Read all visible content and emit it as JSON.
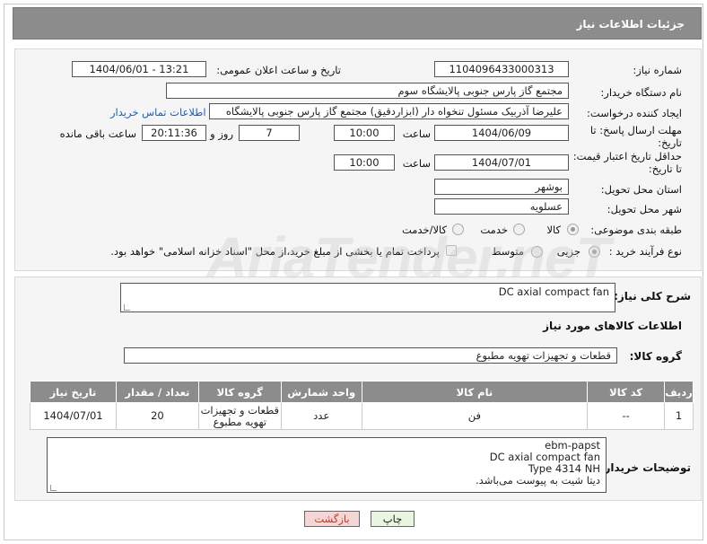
{
  "header": {
    "title": "جزئیات اطلاعات نیاز"
  },
  "form": {
    "need_number_label": "شماره نیاز:",
    "need_number": "1104096433000313",
    "announce_label": "تاریخ و ساعت اعلان عمومی:",
    "announce_value": "1404/06/01 - 13:21",
    "buyer_org_label": "نام دستگاه خریدار:",
    "buyer_org": "مجتمع گاز پارس جنوبی  پالایشگاه سوم",
    "creator_label": "ایجاد کننده درخواست:",
    "creator": "علیرضا آذربیک مسئول تنخواه دار  (ابزاردقیق) مجتمع گاز پارس جنوبی  پالایشگاه",
    "contact_link": "اطلاعات تماس خریدار",
    "deadline_label_1": "مهلت ارسال پاسخ: تا",
    "deadline_label_2": "تاریخ:",
    "deadline_date": "1404/06/09",
    "time_label": "ساعت",
    "deadline_time": "10:00",
    "days_value": "7",
    "days_label": "روز و",
    "remaining_value": "20:11:36",
    "remaining_label": "ساعت باقی مانده",
    "price_valid_label_1": "حداقل تاریخ اعتبار قیمت:",
    "price_valid_label_2": "تا تاریخ:",
    "price_valid_date": "1404/07/01",
    "price_valid_time": "10:00",
    "province_label": "استان محل تحویل:",
    "province": "بوشهر",
    "city_label": "شهر محل تحویل:",
    "city": "عسلویه",
    "category_label": "طبقه بندی موضوعی:",
    "category_options": [
      "کالا",
      "خدمت",
      "کالا/خدمت"
    ],
    "process_label": "نوع فرآیند خرید :",
    "process_options": [
      "جزیی",
      "متوسط"
    ],
    "payment_note": "پرداخت تمام یا بخشی از مبلغ خرید،از محل \"اسناد خزانه اسلامی\" خواهد بود."
  },
  "description": {
    "label": "شرح کلی نیاز:",
    "value": "DC axial compact fan",
    "items_title": "اطلاعات کالاهای مورد نیاز",
    "group_label": "گروه کالا:",
    "group_value": "قطعات و تجهیزات تهویه مطبوع"
  },
  "table": {
    "headers": [
      "ردیف",
      "کد کالا",
      "نام کالا",
      "واحد شمارش",
      "گروه کالا",
      "تعداد / مقدار",
      "تاریخ نیاز"
    ],
    "rows": [
      {
        "row": "1",
        "code": "--",
        "name": "فن",
        "unit": "عدد",
        "group": "قطعات و تجهیزات تهویه مطبوع",
        "qty": "20",
        "date": "1404/07/01"
      }
    ]
  },
  "buyer_notes": {
    "label": "توضیحات خریدار:",
    "lines": [
      "ebm-papst",
      "DC axial compact fan",
      "Type 4314 NH",
      "دیتا شیت به پیوست می‌باشد."
    ]
  },
  "buttons": {
    "print": "چاپ",
    "back": "بازگشت"
  },
  "watermark": "AriaTender.neT",
  "colors": {
    "header_bg": "#8c8c8c",
    "link": "#1a5fb4",
    "back_btn": "#f4d6d6",
    "print_btn": "#e8f5e0"
  }
}
